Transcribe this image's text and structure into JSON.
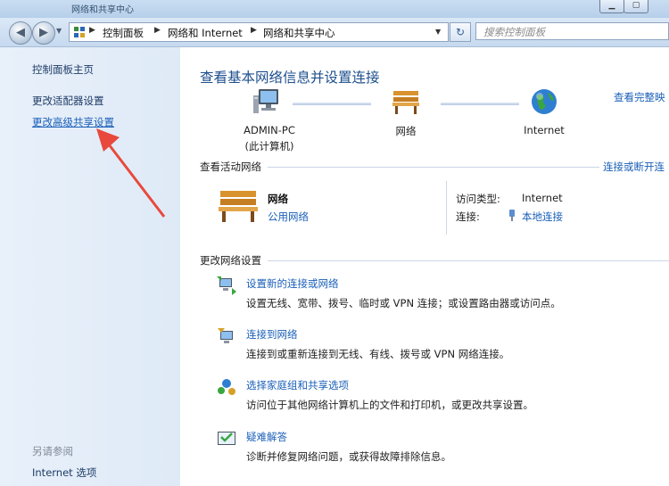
{
  "window": {
    "title": "网络和共享中心",
    "controls": [
      "minimize",
      "maximize"
    ]
  },
  "nav": {
    "breadcrumbs": [
      "控制面板",
      "网络和 Internet",
      "网络和共享中心"
    ],
    "search_placeholder": "搜索控制面板"
  },
  "sidebar": {
    "items": [
      {
        "label": "控制面板主页"
      },
      {
        "label": "更改适配器设置"
      },
      {
        "label": "更改高级共享设置"
      }
    ],
    "see_also_title": "另请参阅",
    "see_also": [
      {
        "label": "Internet 选项"
      }
    ]
  },
  "main": {
    "heading": "查看基本网络信息并设置连接",
    "full_map_link": "查看完整映",
    "map": [
      {
        "label": "ADMIN-PC",
        "sub": "(此计算机)"
      },
      {
        "label": "网络"
      },
      {
        "label": "Internet"
      }
    ],
    "active_title": "查看活动网络",
    "connect_link": "连接或断开连",
    "network": {
      "name": "网络",
      "type": "公用网络",
      "access_label": "访问类型:",
      "access_value": "Internet",
      "conn_label": "连接:",
      "conn_value": "本地连接"
    },
    "change_title": "更改网络设置",
    "tasks": [
      {
        "title": "设置新的连接或网络",
        "desc": "设置无线、宽带、拨号、临时或 VPN 连接；或设置路由器或访问点。",
        "icon": "network-setup-icon"
      },
      {
        "title": "连接到网络",
        "desc": "连接到或重新连接到无线、有线、拨号或 VPN 网络连接。",
        "icon": "connect-network-icon"
      },
      {
        "title": "选择家庭组和共享选项",
        "desc": "访问位于其他网络计算机上的文件和打印机，或更改共享设置。",
        "icon": "homegroup-icon"
      },
      {
        "title": "疑难解答",
        "desc": "诊断并修复网络问题，或获得故障排除信息。",
        "icon": "troubleshoot-icon"
      }
    ]
  },
  "colors": {
    "link": "#1a5fb8",
    "heading": "#1e4f8e",
    "sidebar_bg": "#e4eef9",
    "annotation_arrow": "#e8493c"
  }
}
